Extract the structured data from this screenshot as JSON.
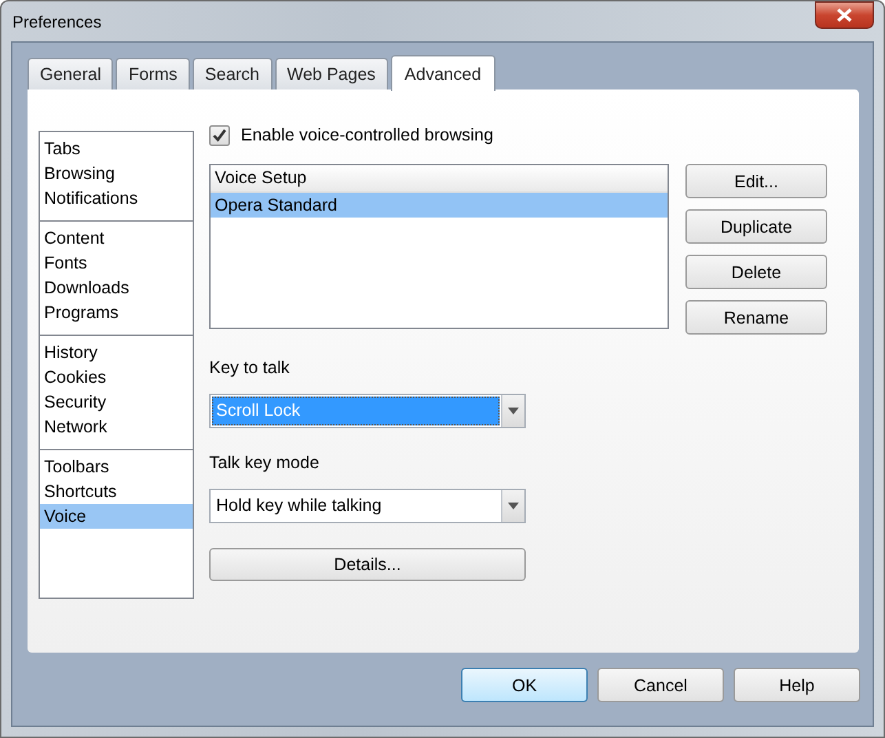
{
  "window": {
    "title": "Preferences"
  },
  "tabs": [
    {
      "label": "General",
      "selected": false
    },
    {
      "label": "Forms",
      "selected": false
    },
    {
      "label": "Search",
      "selected": false
    },
    {
      "label": "Web Pages",
      "selected": false
    },
    {
      "label": "Advanced",
      "selected": true
    }
  ],
  "sidebar": {
    "groups": [
      {
        "items": [
          {
            "label": "Tabs",
            "selected": false
          },
          {
            "label": "Browsing",
            "selected": false
          },
          {
            "label": "Notifications",
            "selected": false
          }
        ]
      },
      {
        "items": [
          {
            "label": "Content",
            "selected": false
          },
          {
            "label": "Fonts",
            "selected": false
          },
          {
            "label": "Downloads",
            "selected": false
          },
          {
            "label": "Programs",
            "selected": false
          }
        ]
      },
      {
        "items": [
          {
            "label": "History",
            "selected": false
          },
          {
            "label": "Cookies",
            "selected": false
          },
          {
            "label": "Security",
            "selected": false
          },
          {
            "label": "Network",
            "selected": false
          }
        ]
      },
      {
        "items": [
          {
            "label": "Toolbars",
            "selected": false
          },
          {
            "label": "Shortcuts",
            "selected": false
          },
          {
            "label": "Voice",
            "selected": true
          }
        ]
      }
    ]
  },
  "enable_voice": {
    "label": "Enable voice-controlled browsing",
    "checked": true
  },
  "voice_setup": {
    "header": "Voice Setup",
    "rows": [
      {
        "label": "Opera Standard",
        "selected": true
      }
    ]
  },
  "setup_buttons": [
    "Edit...",
    "Duplicate",
    "Delete",
    "Rename"
  ],
  "key_to_talk": {
    "label": "Key to talk",
    "value": "Scroll Lock",
    "focused": true
  },
  "talk_key_mode": {
    "label": "Talk key mode",
    "value": "Hold key while talking",
    "focused": false
  },
  "details_button": "Details...",
  "dialog_buttons": [
    {
      "label": "OK",
      "default": true
    },
    {
      "label": "Cancel",
      "default": false
    },
    {
      "label": "Help",
      "default": false
    }
  ]
}
